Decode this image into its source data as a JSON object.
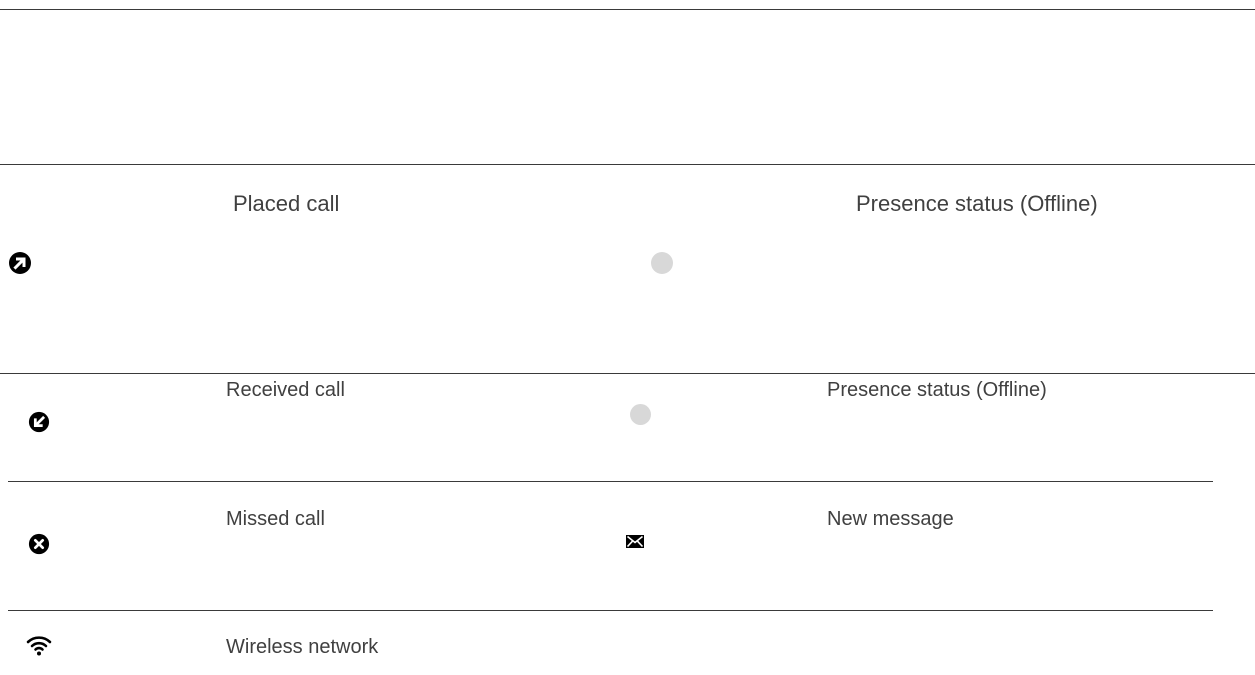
{
  "colors": {
    "text": "#404040",
    "rule": "#3a3a3a",
    "icon": "#000000",
    "presence_offline": "#d8d8d8"
  },
  "rows": [
    {
      "left_icon": "placed-call-icon",
      "left_label": "Placed call",
      "right_icon": "presence-offline-icon",
      "right_label": "Presence status (Offline)"
    },
    {
      "left_icon": "received-call-icon",
      "left_label": "Received call",
      "right_icon": "presence-offline-icon",
      "right_label": "Presence status (Offline)"
    },
    {
      "left_icon": "missed-call-icon",
      "left_label": "Missed call",
      "right_icon": "new-message-icon",
      "right_label": "New message"
    },
    {
      "left_icon": "wireless-network-icon",
      "left_label": "Wireless network"
    }
  ]
}
